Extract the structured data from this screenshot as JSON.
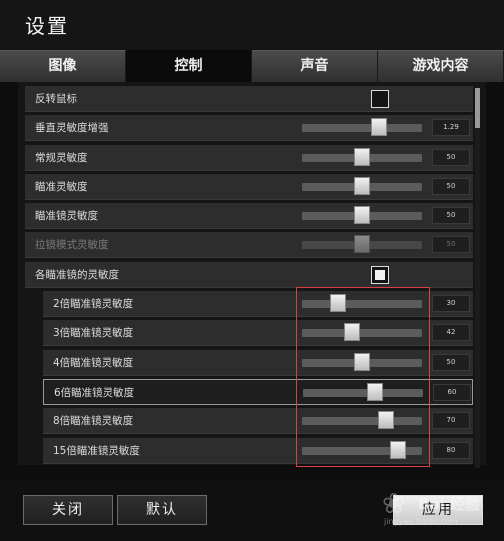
{
  "window": {
    "title": "设置"
  },
  "tabs": [
    {
      "label": "图像",
      "active": false
    },
    {
      "label": "控制",
      "active": true
    },
    {
      "label": "声音",
      "active": false
    },
    {
      "label": "游戏内容",
      "active": false
    }
  ],
  "settings": {
    "invert_mouse": {
      "label": "反转鼠标",
      "checked": false
    },
    "vertical_sensitivity": {
      "label": "垂直灵敏度增强",
      "value_text": "1.29",
      "level": 0.64
    },
    "general_sensitivity": {
      "label": "常规灵敏度",
      "value_text": "50",
      "level": 0.5
    },
    "aim_sensitivity": {
      "label": "瞄准灵敏度",
      "value_text": "50",
      "level": 0.5
    },
    "scope_sensitivity": {
      "label": "瞄准镜灵敏度",
      "value_text": "50",
      "level": 0.5
    },
    "zoom_sensitivity": {
      "label": "拉镜模式灵敏度",
      "value_text": "50",
      "level": 0.5,
      "disabled": true
    },
    "per_scope_sensitivity": {
      "label": "各瞄准镜的灵敏度",
      "checked": true
    },
    "scopes": [
      {
        "label": "2倍瞄准镜灵敏度",
        "value_text": "30",
        "level": 0.3
      },
      {
        "label": "3倍瞄准镜灵敏度",
        "value_text": "42",
        "level": 0.42
      },
      {
        "label": "4倍瞄准镜灵敏度",
        "value_text": "50",
        "level": 0.5
      },
      {
        "label": "6倍瞄准镜灵敏度",
        "value_text": "60",
        "level": 0.6,
        "selected": true
      },
      {
        "label": "8倍瞄准镜灵敏度",
        "value_text": "70",
        "level": 0.7
      },
      {
        "label": "15倍瞄准镜灵敏度",
        "value_text": "80",
        "level": 0.8
      }
    ]
  },
  "footer": {
    "close_label": "关闭",
    "default_label": "默认",
    "apply_label": "应用"
  },
  "watermark": {
    "text": "Bai 经验",
    "url": "jingyan.baidu.com"
  },
  "colors": {
    "highlight_border": "#d9414a",
    "active_tab": "#0b0b0b"
  }
}
